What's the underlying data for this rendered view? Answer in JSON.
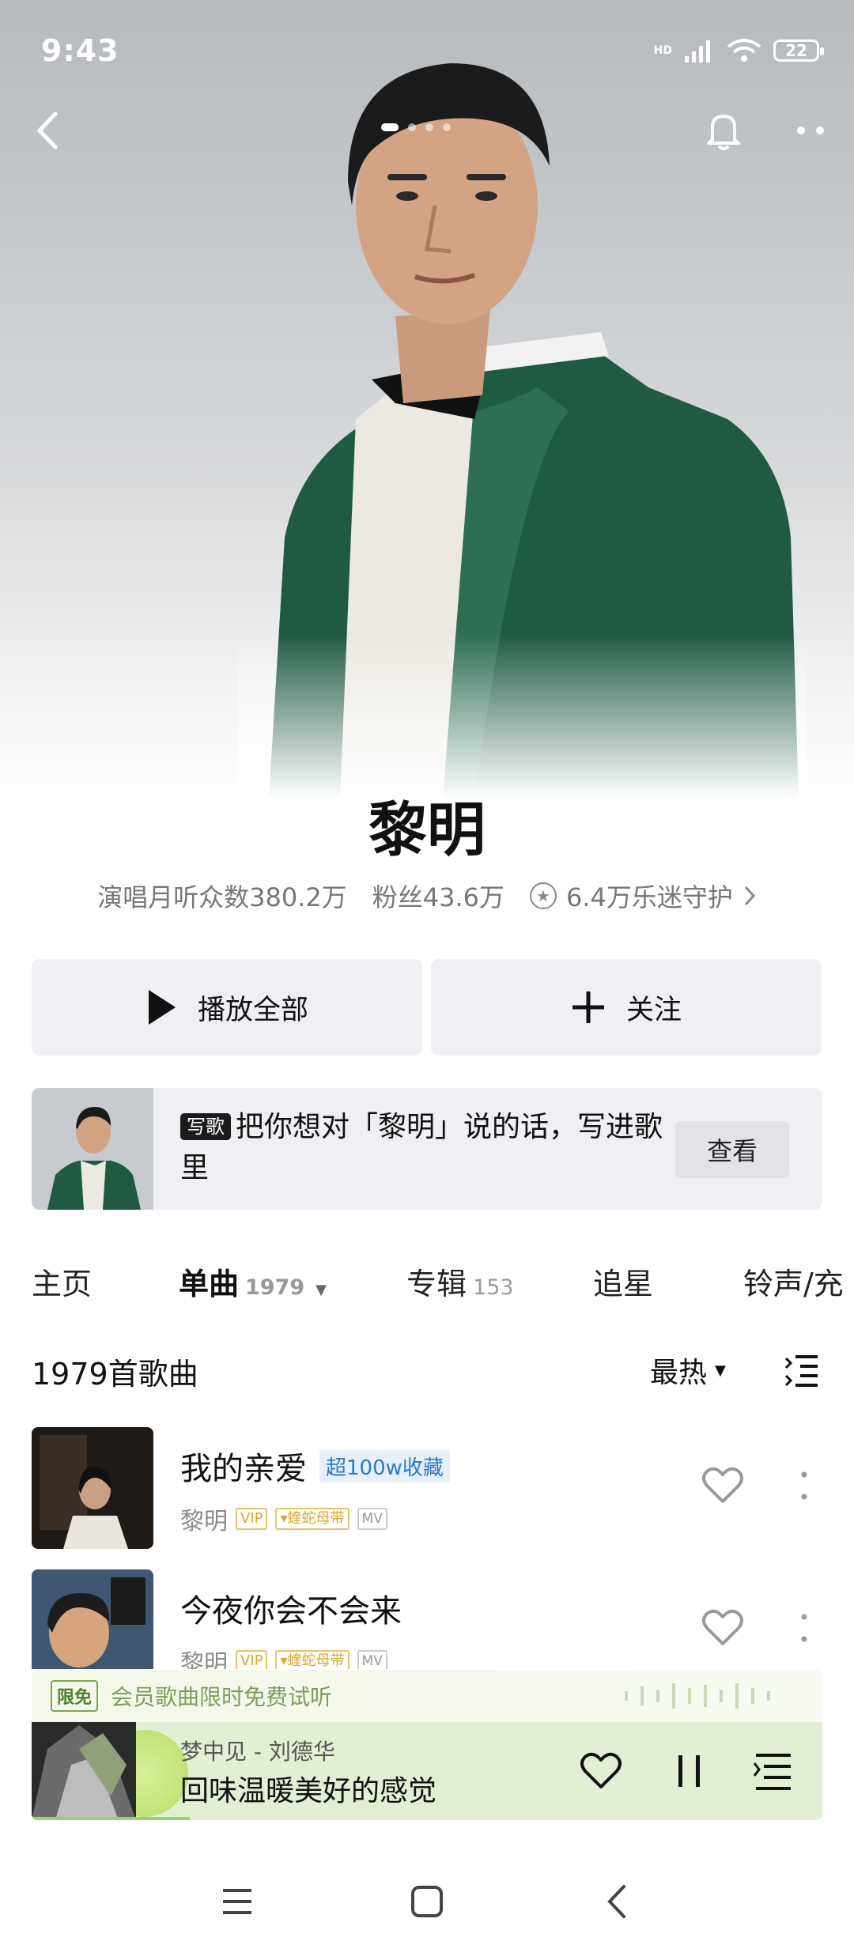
{
  "status": {
    "time": "9:43",
    "network": "HD",
    "battery": "22"
  },
  "artist": {
    "name": "黎明",
    "monthly_listeners": "演唱月听众数380.2万",
    "fans": "粉丝43.6万",
    "guardians": "6.4万乐迷守护"
  },
  "actions": {
    "play_all": "播放全部",
    "follow": "关注"
  },
  "banner": {
    "tag": "写歌",
    "text": "把你想对「黎明」说的话，写进歌里",
    "button": "查看"
  },
  "tabs": [
    {
      "label": "主页",
      "count": ""
    },
    {
      "label": "单曲",
      "count": "1979"
    },
    {
      "label": "专辑",
      "count": "153"
    },
    {
      "label": "追星",
      "count": ""
    },
    {
      "label": "铃声/充",
      "count": ""
    }
  ],
  "songlist": {
    "title": "1979首歌曲",
    "sort": "最热"
  },
  "songs": [
    {
      "title": "我的亲爱",
      "badge": "超100w收藏",
      "artist": "黎明",
      "vip": "VIP",
      "tag": "蝰蛇母带",
      "mv": "MV"
    },
    {
      "title": "今夜你会不会来",
      "badge": "",
      "artist": "黎明",
      "vip": "VIP",
      "tag": "蝰蛇母带",
      "mv": "MV"
    }
  ],
  "trial": {
    "tag": "限免",
    "text": "会员歌曲限时免费试听"
  },
  "player": {
    "track_artist": "梦中见 - 刘德华",
    "lyric": "回味温暖美好的感觉",
    "progress": 0.2
  },
  "colors": {
    "accent_green": "#e2efd2",
    "button_bg": "#eff0f4",
    "badge_blue": "#2f79c7",
    "vip_gold": "#d9a630"
  },
  "icons": [
    "back-icon",
    "bell-icon",
    "more-icon",
    "play-icon",
    "plus-icon",
    "star-icon",
    "chevron-right-icon",
    "caret-down-icon",
    "list-icon",
    "heart-icon",
    "more-vertical-icon",
    "pause-icon",
    "queue-icon",
    "menu-icon",
    "home-icon",
    "nav-back-icon"
  ]
}
